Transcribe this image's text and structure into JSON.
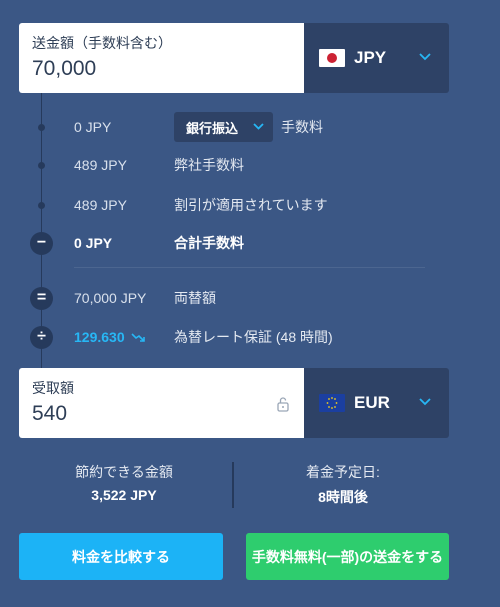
{
  "send": {
    "label": "送金額（手数料含む）",
    "amount": "70,000",
    "currency": "JPY",
    "flag": "jp-flag-icon"
  },
  "fees": {
    "method_fee_amount": "0 JPY",
    "method_label": "銀行振込",
    "method_suffix": "手数料",
    "our_fee_amount": "489 JPY",
    "our_fee_label": "弊社手数料",
    "discount_amount": "489 JPY",
    "discount_label": "割引が適用されています",
    "total_amount": "0 JPY",
    "total_label": "合計手数料",
    "converted_amount": "70,000 JPY",
    "converted_label": "両替額",
    "rate_value": "129.630",
    "rate_label": "為替レート保証 (48 時間)"
  },
  "receive": {
    "label": "受取額",
    "amount": "540",
    "currency": "EUR",
    "flag": "eu-flag-icon"
  },
  "summary": {
    "savings_label": "節約できる金額",
    "savings_value": "3,522 JPY",
    "arrival_label": "着金予定日:",
    "arrival_value": "8時間後"
  },
  "buttons": {
    "compare": "料金を比較する",
    "send": "手数料無料(一部)の送金をする"
  },
  "colors": {
    "background": "#3b5785",
    "accent_blue": "#1cb3f6",
    "accent_green": "#2ecd6e",
    "rate_blue": "#27b7f5"
  }
}
